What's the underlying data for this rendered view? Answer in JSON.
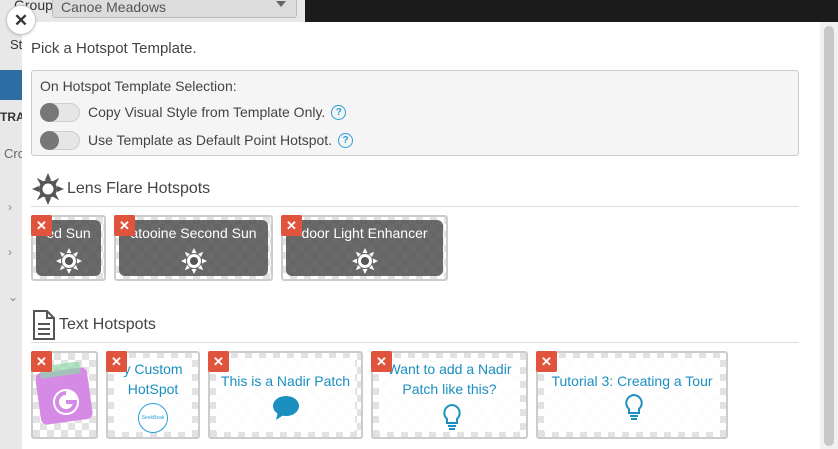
{
  "background": {
    "group_label": "Group",
    "group_value": "Canoe Meadows",
    "st_label": "St",
    "tra_label": "TRA",
    "cro_label": "Cro"
  },
  "modal": {
    "close_icon": "close-icon",
    "title": "Pick a Hotspot Template.",
    "options": {
      "heading": "On Hotspot Template Selection:",
      "items": [
        {
          "label": "Copy Visual Style from Template Only.",
          "help": "?"
        },
        {
          "label": "Use Template as Default Point Hotspot.",
          "help": "?"
        }
      ]
    },
    "sections": [
      {
        "title": "Lens Flare Hotspots",
        "icon": "sun-icon",
        "cards": [
          {
            "name": "Red Sun",
            "shown_text": "ed Sun"
          },
          {
            "name": "Tatooine Second Sun",
            "shown_text": "atooine Second Sun"
          },
          {
            "name": "Indoor Light Enhancer",
            "shown_text": "door Light Enhancer"
          }
        ]
      },
      {
        "title": "Text Hotspots",
        "icon": "document-icon",
        "cards": [
          {
            "name": "Google",
            "icon": "google-logo-icon"
          },
          {
            "name": "My Custom HotSpot",
            "shown_text": "y Custom HotSpot",
            "badge": "SeekBeak"
          },
          {
            "name": "This is a Nadir Patch",
            "shown_text": "This is a Nadir Patch",
            "icon": "speech-bubble-icon"
          },
          {
            "name": "Want to add a Nadir Patch like this?",
            "shown_text": "Want to add a Nadir Patch like this?",
            "icon": "lightbulb-icon"
          },
          {
            "name": "Tutorial 3: Creating a Tour",
            "shown_text": "Tutorial 3: Creating a Tour",
            "icon": "lightbulb-icon"
          }
        ]
      }
    ],
    "colors": {
      "accent": "#1b8fc0",
      "delete": "#e0533d"
    }
  }
}
